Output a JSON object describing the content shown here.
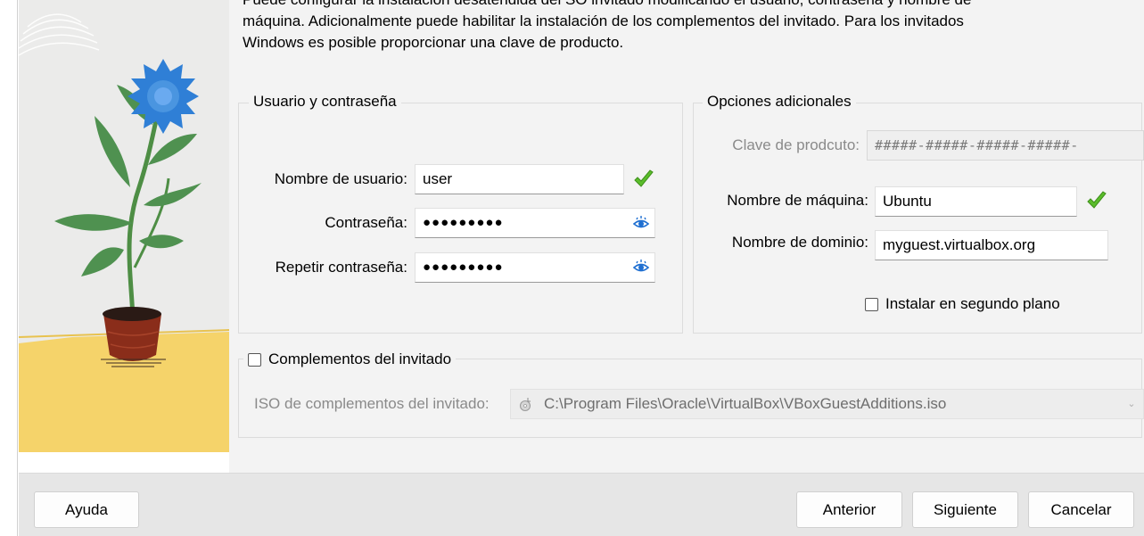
{
  "intro": {
    "line1": "Puede configurar la instalación desatendida del SO invitado modificando el usuario, contraseña y nombre de",
    "line2": "máquina. Adicionalmente puede habilitar la instalación de los complementos del invitado. Para los invitados",
    "line3": "Windows es posible proporcionar una clave de producto."
  },
  "user_group": {
    "title": "Usuario y contraseña",
    "username_label": "Nombre de usuario:",
    "username_value": "user",
    "password_label": "Contraseña:",
    "password_value": "●●●●●●●●●",
    "repeat_label": "Repetir contraseña:",
    "repeat_value": "●●●●●●●●●"
  },
  "extra_group": {
    "title": "Opciones adicionales",
    "product_key_label": "Clave de prodcuto:",
    "product_key_value": "#####-#####-#####-#####-",
    "hostname_label": "Nombre de máquina:",
    "hostname_value": "Ubuntu",
    "domain_label": "Nombre de dominio:",
    "domain_value": "myguest.virtualbox.org",
    "background_label": "Instalar en segundo plano",
    "background_checked": false
  },
  "additions_group": {
    "title": "Complementos del invitado",
    "checked": false,
    "iso_label": "ISO de complementos del invitado:",
    "iso_value": "C:\\Program Files\\Oracle\\VirtualBox\\VBoxGuestAdditions.iso"
  },
  "footer": {
    "help": "Ayuda",
    "back": "Anterior",
    "next": "Siguiente",
    "cancel": "Cancelar"
  },
  "icons": {
    "valid": "check-icon",
    "reveal": "eye-icon",
    "disc": "disc-icon",
    "dropdown": "chevron-down-icon"
  },
  "colors": {
    "valid_green": "#5bbd2b",
    "eye_blue": "#1f6fd1",
    "flower_blue": "#2f7fd6",
    "floor_yellow": "#f5d36a"
  }
}
